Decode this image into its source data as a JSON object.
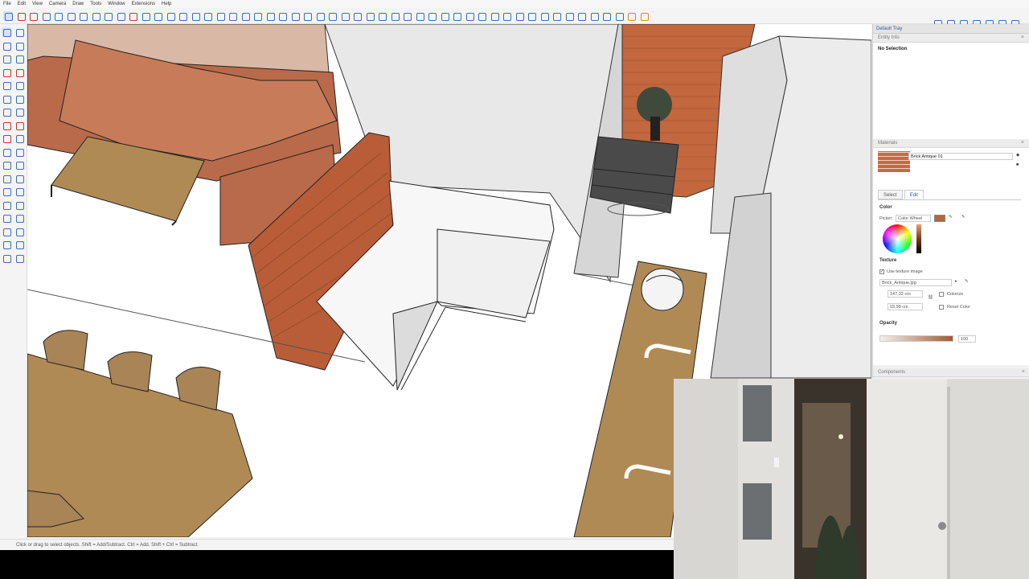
{
  "menu": [
    "File",
    "Edit",
    "View",
    "Camera",
    "Draw",
    "Tools",
    "Window",
    "Extensions",
    "Help"
  ],
  "tray": {
    "title": "Default Tray",
    "entity_info": {
      "label": "Entity Info",
      "selection": "No Selection"
    },
    "materials": {
      "label": "Materials",
      "material_name": "Brick Antique 01",
      "tabs": [
        "Select",
        "Edit"
      ],
      "active_tab": "Edit",
      "color_label": "Color",
      "picker_label": "Picker:",
      "picker_value": "Color Wheel",
      "texture_label": "Texture",
      "use_texture_label": "Use texture image",
      "use_texture_checked": true,
      "texture_file": "Brick_Antique.jpg",
      "width": "147,32 cm",
      "height": "93,98 cm",
      "colorize_label": "Colorize",
      "reset_color_label": "Reset Color",
      "opacity_label": "Opacity",
      "opacity_value": "100",
      "swatch_color": "#b5643b"
    },
    "components_label": "Components"
  },
  "status": {
    "text": "Click or drag to select objects. Shift = Add/Subtract. Ctrl = Add. Shift + Ctrl = Subtract."
  },
  "colors": {
    "accent": "#2a5aa8",
    "brick": "#b5643b",
    "sofa": "#b96a4a",
    "wood": "#b08a55"
  }
}
